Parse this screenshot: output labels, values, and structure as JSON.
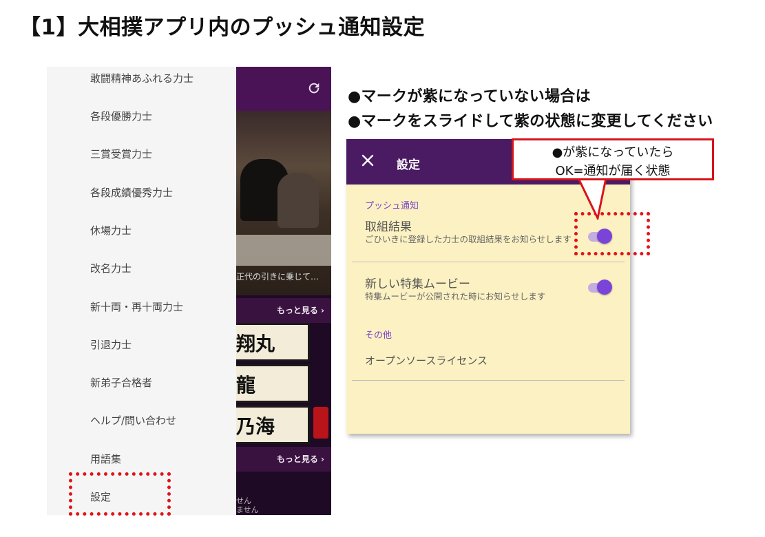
{
  "title": "【1】大相撲アプリ内のプッシュ通知設定",
  "drawer": {
    "items": [
      "敢闘精神あふれる力士",
      "各段優勝力士",
      "三賞受賞力士",
      "各段成績優秀力士",
      "休場力士",
      "改名力士",
      "新十両・再十両力士",
      "引退力士",
      "新弟子合格者",
      "ヘルプ/問い合わせ",
      "用語集",
      "設定"
    ]
  },
  "app": {
    "video_caption": "正代の引きに乗じて…",
    "more_label": "もっと見る ›",
    "names": [
      "翔丸",
      "龍",
      "乃海"
    ],
    "bottom_text": "せん\nません"
  },
  "notes": [
    "●マークが紫になっていない場合は",
    "●マークをスライドして紫の状態に変更してください"
  ],
  "settings": {
    "title": "設定",
    "section_push": "プッシュ通知",
    "item1_name": "取組結果",
    "item1_desc": "ごひいきに登録した力士の取組結果をお知らせします",
    "item2_name": "新しい特集ムービー",
    "item2_desc": "特集ムービーが公開された時にお知らせします",
    "section_other": "その他",
    "item3_name": "オープンソースライセンス",
    "item1_enabled": true,
    "item2_enabled": true
  },
  "callout": {
    "line1": "●が紫になっていたら",
    "line2": "OK=通知が届く状態"
  },
  "colors": {
    "accent": "#7a44d8",
    "header": "#4a1a62",
    "highlight": "#e0141a"
  }
}
